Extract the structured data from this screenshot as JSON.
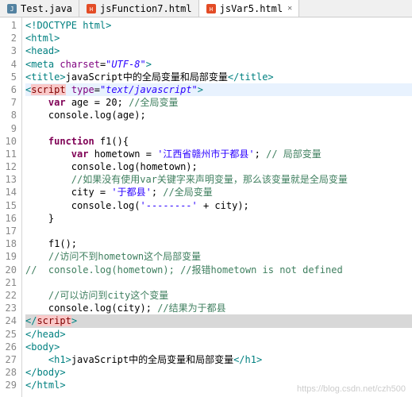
{
  "tabs": [
    {
      "label": "Test.java",
      "active": false,
      "icon": "java"
    },
    {
      "label": "jsFunction7.html",
      "active": false,
      "icon": "html"
    },
    {
      "label": "jsVar5.html",
      "active": true,
      "icon": "html"
    }
  ],
  "watermark": "https://blog.csdn.net/czh500",
  "code": {
    "l1": "<!DOCTYPE html>",
    "l2o": "<",
    "l2t": "html",
    "l2c": ">",
    "l3o": "<",
    "l3t": "head",
    "l3c": ">",
    "l4o": "<",
    "l4t": "meta",
    "l4a": " charset",
    "l4e": "=",
    "l4v": "\"UTF-8\"",
    "l4c": ">",
    "l5o": "<",
    "l5t": "title",
    "l5c": ">",
    "l5x": "javaScript中的全局变量和局部变量",
    "l5co": "</",
    "l5cc": ">",
    "l6o": "<",
    "l6t": "script",
    "l6a": " type",
    "l6e": "=",
    "l6v": "\"text/javascript\"",
    "l6c": ">",
    "l7i": "    ",
    "l7k": "var",
    "l7x": " age = 20; ",
    "l7c": "//全局变量",
    "l8i": "    ",
    "l8x": "console.log(age);",
    "l9": "",
    "l10i": "    ",
    "l10k": "function",
    "l10x": " f1(){",
    "l11i": "        ",
    "l11k": "var",
    "l11x": " hometown = ",
    "l11s": "'江西省赣州市于都县'",
    "l11x2": "; ",
    "l11c": "// 局部变量",
    "l12i": "        ",
    "l12x": "console.log(hometown);",
    "l13i": "        ",
    "l13c": "//如果没有使用var关键字来声明变量，那么该变量就是全局变量",
    "l14i": "        ",
    "l14x": "city = ",
    "l14s": "'于都县'",
    "l14x2": "; ",
    "l14c": "//全局变量",
    "l15i": "        ",
    "l15x": "console.log(",
    "l15s": "'--------'",
    "l15x2": " + city);",
    "l16i": "    ",
    "l16x": "}",
    "l17": "",
    "l18i": "    ",
    "l18x": "f1();",
    "l19i": "    ",
    "l19c": "//访问不到hometown这个局部变量",
    "l20c": "//  console.log(hometown); //报错hometown is not defined",
    "l21": "",
    "l22i": "    ",
    "l22c": "//可以访问到city这个变量",
    "l23i": "    ",
    "l23x": "console.log(city); ",
    "l23c": "//结果为于都县",
    "l24o": "</",
    "l24t": "script",
    "l24c": ">",
    "l25o": "</",
    "l25t": "head",
    "l25c": ">",
    "l26o": "<",
    "l26t": "body",
    "l26c": ">",
    "l27i": "    ",
    "l27o": "<",
    "l27t": "h1",
    "l27c": ">",
    "l27x": "javaScript中的全局变量和局部变量",
    "l27co": "</",
    "l27cc": ">",
    "l28o": "</",
    "l28t": "body",
    "l28c": ">",
    "l29o": "</",
    "l29t": "html",
    "l29c": ">"
  }
}
